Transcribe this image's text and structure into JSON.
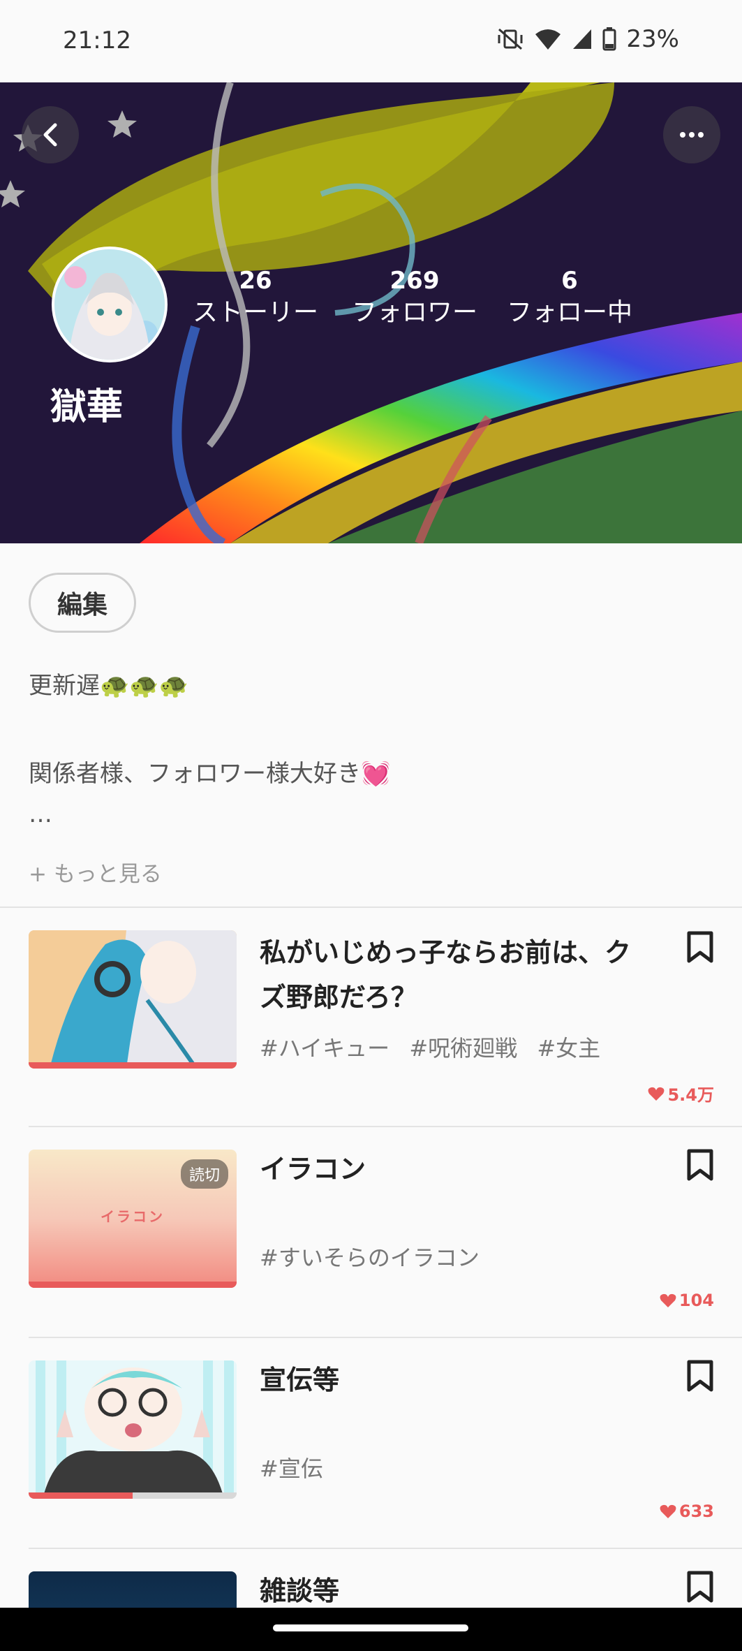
{
  "status_bar": {
    "time": "21:12",
    "battery": "23%"
  },
  "profile": {
    "name": "獄華",
    "stats": [
      {
        "value": "26",
        "label": "ストーリー"
      },
      {
        "value": "269",
        "label": "フォロワー"
      },
      {
        "value": "6",
        "label": "フォロー中"
      }
    ],
    "edit_label": "編集",
    "bio_line1": "更新遅🐢🐢🐢",
    "bio_line2": "関係者様、フォロワー様大好き💓",
    "bio_ellipsis": "…",
    "more_label": "+ もっと見る"
  },
  "stories": [
    {
      "title": "私がいじめっ子ならお前は、クズ野郎だろ？",
      "tags": "#ハイキュー #呪術廻戦 #女主",
      "likes": "5.4万",
      "read_progress": 1.0,
      "badge": ""
    },
    {
      "title": "イラコン",
      "tags": "#すいそらのイラコン",
      "likes": "104",
      "read_progress": 1.0,
      "badge": "読切",
      "thumb_text": "イラコン"
    },
    {
      "title": "宣伝等",
      "tags": "#宣伝",
      "likes": "633",
      "read_progress": 0.5,
      "badge": ""
    },
    {
      "title": "雑談等",
      "tags": "",
      "likes": "",
      "read_progress": 0,
      "badge": ""
    }
  ],
  "colors": {
    "accent": "#e85a5a",
    "header_bg": "#22163a"
  },
  "icons": {
    "back": "chevron-left-icon",
    "more": "more-horizontal-icon",
    "bookmark": "bookmark-icon",
    "like": "heart-icon"
  }
}
